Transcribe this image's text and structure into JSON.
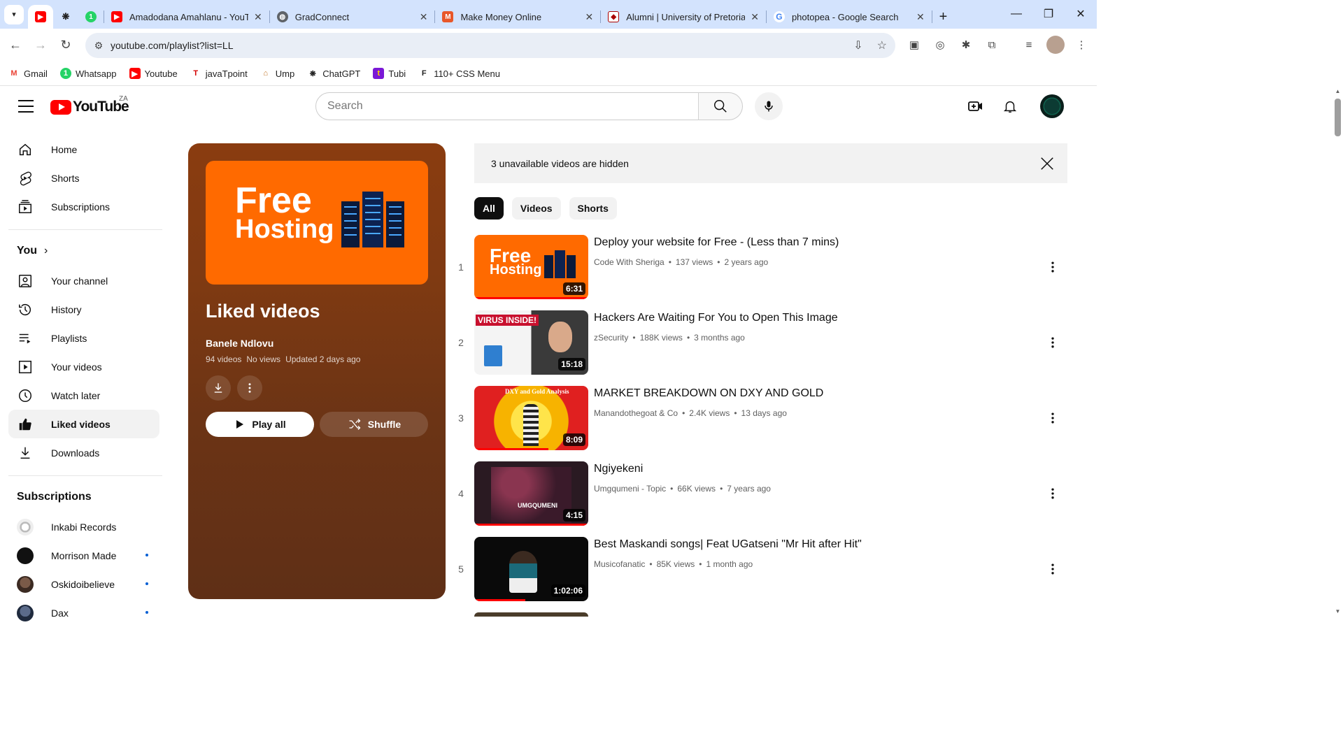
{
  "browser": {
    "tabs": [
      {
        "title": "",
        "favicon": "youtube",
        "active": true
      },
      {
        "title": "",
        "favicon": "chatgpt"
      },
      {
        "title": "",
        "favicon": "whatsapp"
      },
      {
        "title": "Amadodana Amahlanu - YouT",
        "favicon": "youtube"
      },
      {
        "title": "GradConnect",
        "favicon": "globe"
      },
      {
        "title": "Make Money Online",
        "favicon": "mmo"
      },
      {
        "title": "Alumni | University of Pretoria",
        "favicon": "up"
      },
      {
        "title": "photopea - Google Search",
        "favicon": "google"
      }
    ],
    "url": "youtube.com/playlist?list=LL",
    "bookmarks": [
      {
        "label": "Gmail",
        "icon": "gmail-icon"
      },
      {
        "label": "Whatsapp",
        "icon": "whatsapp-icon"
      },
      {
        "label": "Youtube",
        "icon": "youtube-icon"
      },
      {
        "label": "javaTpoint",
        "icon": "javatpoint-icon"
      },
      {
        "label": "Ump",
        "icon": "ump-icon"
      },
      {
        "label": "ChatGPT",
        "icon": "chatgpt-icon"
      },
      {
        "label": "Tubi",
        "icon": "tubi-icon"
      },
      {
        "label": "110+ CSS Menu",
        "icon": "css-icon"
      }
    ]
  },
  "youtube": {
    "logo_text": "YouTube",
    "country": "ZA",
    "search_placeholder": "Search"
  },
  "sidebar": {
    "main": [
      {
        "label": "Home",
        "icon": "home-icon"
      },
      {
        "label": "Shorts",
        "icon": "shorts-icon"
      },
      {
        "label": "Subscriptions",
        "icon": "subscriptions-icon"
      }
    ],
    "you_header": "You",
    "you": [
      {
        "label": "Your channel",
        "icon": "channel-icon"
      },
      {
        "label": "History",
        "icon": "history-icon"
      },
      {
        "label": "Playlists",
        "icon": "playlists-icon"
      },
      {
        "label": "Your videos",
        "icon": "your-videos-icon"
      },
      {
        "label": "Watch later",
        "icon": "watch-later-icon"
      },
      {
        "label": "Liked videos",
        "icon": "like-icon",
        "active": true
      },
      {
        "label": "Downloads",
        "icon": "download-icon"
      }
    ],
    "subs_header": "Subscriptions",
    "subscriptions": [
      {
        "label": "Inkabi Records",
        "dot": false,
        "color": "#d9d9d9"
      },
      {
        "label": "Morrison Made",
        "dot": true,
        "color": "#111111"
      },
      {
        "label": "Oskidoibelieve",
        "dot": true,
        "color": "#6b4a3a"
      },
      {
        "label": "Dax",
        "dot": true,
        "color": "#2e3c55"
      }
    ]
  },
  "playlist": {
    "thumb_line1": "Free",
    "thumb_line2": "Hosting",
    "title": "Liked videos",
    "owner": "Banele Ndlovu",
    "count": "94 videos",
    "views": "No views",
    "updated": "Updated 2 days ago",
    "play_all": "Play all",
    "shuffle": "Shuffle"
  },
  "notice": "3 unavailable videos are hidden",
  "chips": [
    "All",
    "Videos",
    "Shorts"
  ],
  "videos": [
    {
      "index": "1",
      "title": "Deploy your website for Free - (Less than 7 mins)",
      "channel": "Code With Sheriga",
      "views": "137 views",
      "age": "2 years ago",
      "duration": "6:31",
      "progress": 1.0
    },
    {
      "index": "2",
      "title": "Hackers Are Waiting For You to Open This Image",
      "channel": "zSecurity",
      "views": "188K views",
      "age": "3 months ago",
      "duration": "15:18",
      "progress": 0.0
    },
    {
      "index": "3",
      "title": "MARKET BREAKDOWN ON DXY AND GOLD",
      "channel": "Manandothegoat & Co",
      "views": "2.4K views",
      "age": "13 days ago",
      "duration": "8:09",
      "progress": 0.65,
      "thumb_text": "DXY and Gold Analysis"
    },
    {
      "index": "4",
      "title": "Ngiyekeni",
      "channel": "Umgqumeni - Topic",
      "views": "66K views",
      "age": "7 years ago",
      "duration": "4:15",
      "progress": 1.0,
      "thumb_text": "UMGQUMENI"
    },
    {
      "index": "5",
      "title": "Best Maskandi songs| Feat UGatseni \"Mr Hit after Hit\"",
      "channel": "Musicofanatic",
      "views": "85K views",
      "age": "1 month ago",
      "duration": "1:02:06",
      "progress": 0.45
    }
  ]
}
